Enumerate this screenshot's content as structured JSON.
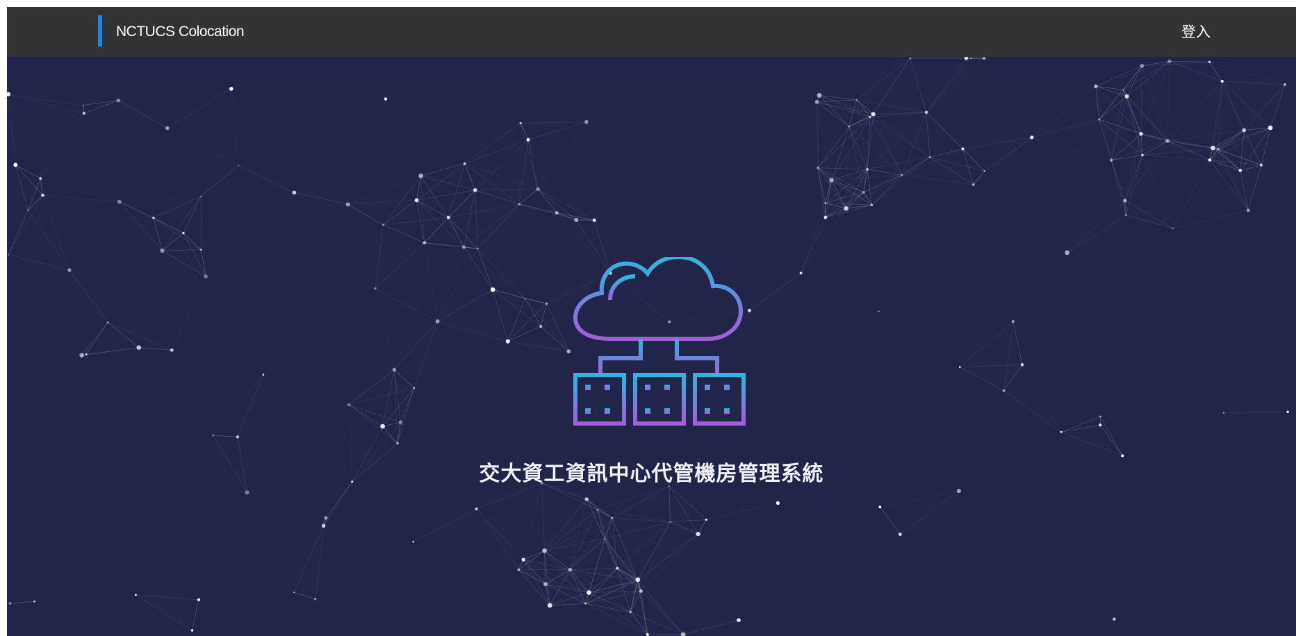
{
  "colors": {
    "background": "#22254a",
    "navbar": "#333333",
    "accent": "#1e88e5",
    "icon_gradient_top": "#2fb6e0",
    "icon_gradient_bottom": "#a45cd8"
  },
  "header": {
    "brand": "NCTUCS Colocation",
    "login_label": "登入"
  },
  "hero": {
    "icon": "cloud-server-icon",
    "title": "交大資工資訊中心代管機房管理系統"
  },
  "background": {
    "effect": "particle-network"
  }
}
